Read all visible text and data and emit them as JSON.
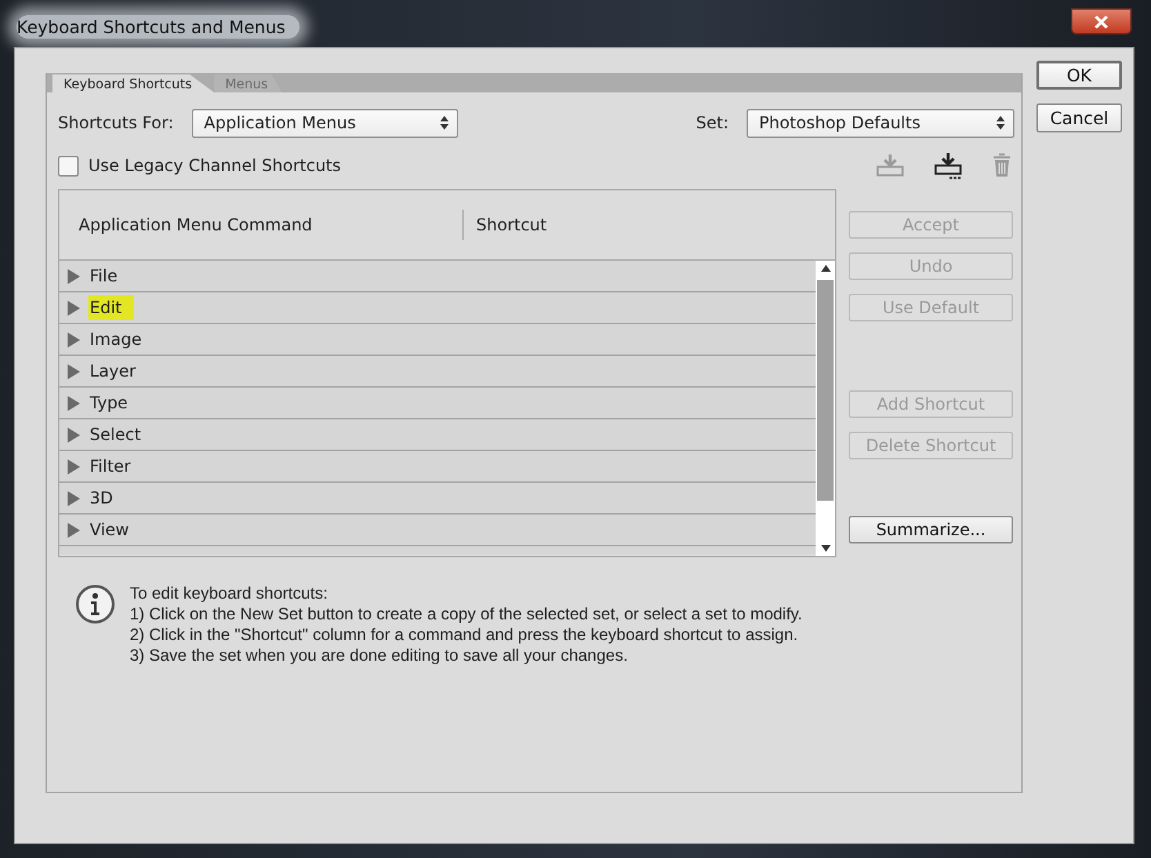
{
  "window": {
    "title": "Keyboard Shortcuts and Menus"
  },
  "tabs": [
    {
      "label": "Keyboard Shortcuts",
      "selected": true
    },
    {
      "label": "Menus",
      "selected": false
    }
  ],
  "shortcuts_for": {
    "label": "Shortcuts For:",
    "value": "Application Menus"
  },
  "set": {
    "label": "Set:",
    "value": "Photoshop Defaults"
  },
  "legacy_checkbox": {
    "label": "Use Legacy Channel Shortcuts",
    "checked": false
  },
  "set_icons": [
    {
      "kind": "save",
      "disabled": true
    },
    {
      "kind": "new",
      "disabled": false
    },
    {
      "kind": "delete",
      "disabled": true
    }
  ],
  "table": {
    "columns": [
      "Application Menu Command",
      "Shortcut"
    ],
    "rows": [
      {
        "label": "File",
        "highlighted": false
      },
      {
        "label": "Edit",
        "highlighted": true
      },
      {
        "label": "Image",
        "highlighted": false
      },
      {
        "label": "Layer",
        "highlighted": false
      },
      {
        "label": "Type",
        "highlighted": false
      },
      {
        "label": "Select",
        "highlighted": false
      },
      {
        "label": "Filter",
        "highlighted": false
      },
      {
        "label": "3D",
        "highlighted": false
      },
      {
        "label": "View",
        "highlighted": false
      }
    ]
  },
  "side_buttons": [
    {
      "label": "Accept",
      "disabled": true,
      "kind": "button"
    },
    {
      "label": "Undo",
      "disabled": true,
      "kind": "button"
    },
    {
      "label": "Use Default",
      "disabled": true,
      "kind": "button"
    },
    {
      "kind": "gap"
    },
    {
      "label": "Add Shortcut",
      "disabled": true,
      "kind": "button"
    },
    {
      "label": "Delete Shortcut",
      "disabled": true,
      "kind": "button"
    },
    {
      "kind": "gap"
    },
    {
      "label": "Summarize...",
      "disabled": false,
      "kind": "button"
    }
  ],
  "info": {
    "lines": [
      "To edit keyboard shortcuts:",
      "1) Click on the New Set button to create a copy of the selected set, or select a set to modify.",
      "2) Click in the \"Shortcut\" column for a command and press the keyboard shortcut to assign.",
      "3) Save the set when you are done editing to save all your changes."
    ]
  },
  "dialog_buttons": [
    "OK",
    "Cancel"
  ]
}
